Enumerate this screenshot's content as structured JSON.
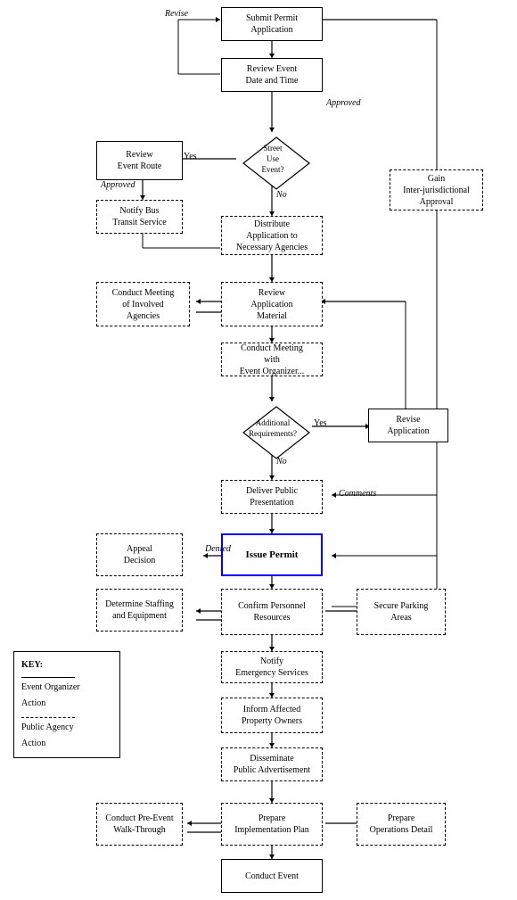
{
  "boxes": {
    "submit_permit": {
      "label": "Submit Permit\nApplication"
    },
    "review_event_date": {
      "label": "Review Event\nDate and Time"
    },
    "review_event_route": {
      "label": "Review\nEvent Route"
    },
    "notify_bus": {
      "label": "Notify Bus\nTransit Service"
    },
    "gain_inter": {
      "label": "Gain\nInter-jurisdictional\nApproval"
    },
    "distribute": {
      "label": "Distribute\nApplication to\nNecessary Agencies"
    },
    "conduct_meeting_agencies": {
      "label": "Conduct Meeting\nof Involved\nAgencies"
    },
    "review_application": {
      "label": "Review\nApplication\nMaterial"
    },
    "conduct_meeting_organizer": {
      "label": "Conduct Meeting\nwith\nEvent Organizer..."
    },
    "revise_application": {
      "label": "Revise\nApplication"
    },
    "deliver_presentation": {
      "label": "Deliver Public\nPresentation"
    },
    "appeal_decision": {
      "label": "Appeal\nDecision"
    },
    "issue_permit": {
      "label": "Issue Permit"
    },
    "determine_staffing": {
      "label": "Determine Staffing\nand Equipment"
    },
    "confirm_personnel": {
      "label": "Confirm Personnel\nResources"
    },
    "secure_parking": {
      "label": "Secure Parking\nAreas"
    },
    "notify_emergency": {
      "label": "Notify\nEmergency Services"
    },
    "inform_affected": {
      "label": "Inform Affected\nProperty Owners"
    },
    "disseminate": {
      "label": "Disseminate\nPublic Advertisement"
    },
    "conduct_pre_event": {
      "label": "Conduct Pre-Event\nWalk-Through"
    },
    "prepare_implementation": {
      "label": "Prepare\nImplementation Plan"
    },
    "prepare_operations": {
      "label": "Prepare\nOperations Detail"
    },
    "conduct_event": {
      "label": "Conduct Event"
    }
  },
  "diamonds": {
    "street_use": {
      "label": "Street\nUse\nEvent?"
    },
    "additional_req": {
      "label": "Additional\nRequirements?"
    }
  },
  "labels": {
    "revise": "Revise",
    "approved1": "Approved",
    "yes": "Yes",
    "no": "No",
    "approved2": "Approved",
    "denied": "Denied",
    "comments": "Comments",
    "yes2": "Yes",
    "no2": "No"
  },
  "key": {
    "title": "KEY:",
    "event_organizer": "Event Organizer\nAction",
    "public_agency": "Public Agency\nAction"
  }
}
